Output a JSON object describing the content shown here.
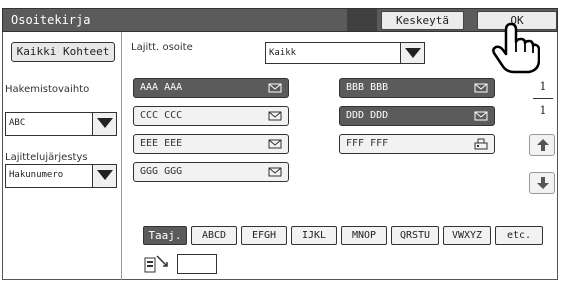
{
  "header": {
    "title": "Osoitekirja",
    "cancel_label": "Keskeytä",
    "ok_label": "OK"
  },
  "sidebar": {
    "all_destinations_label": "Kaikki Kohteet",
    "search_switch_label": "Hakemistovaihto",
    "search_switch_value": "ABC",
    "sort_order_label": "Lajittelujärjestys",
    "sort_order_value": "Hakunumero"
  },
  "filter": {
    "label": "Lajitt. osoite",
    "value": "Kaikk"
  },
  "addresses": [
    {
      "name": "AAA AAA",
      "type": "email",
      "selected": true
    },
    {
      "name": "BBB BBB",
      "type": "email",
      "selected": true
    },
    {
      "name": "CCC CCC",
      "type": "email",
      "selected": false
    },
    {
      "name": "DDD DDD",
      "type": "email",
      "selected": true
    },
    {
      "name": "EEE EEE",
      "type": "email",
      "selected": false
    },
    {
      "name": "FFF FFF",
      "type": "fax",
      "selected": false
    },
    {
      "name": "GGG GGG",
      "type": "email",
      "selected": false
    }
  ],
  "pagination": {
    "current": "1",
    "total": "1"
  },
  "index_tabs": [
    {
      "label": "Taaj.",
      "active": true
    },
    {
      "label": "ABCD",
      "active": false
    },
    {
      "label": "EFGH",
      "active": false
    },
    {
      "label": "IJKL",
      "active": false
    },
    {
      "label": "MNOP",
      "active": false
    },
    {
      "label": "QRSTU",
      "active": false
    },
    {
      "label": "VWXYZ",
      "active": false
    },
    {
      "label": "etc.",
      "active": false
    }
  ],
  "direct_input": {
    "value": ""
  },
  "colors": {
    "selected_bg": "#5b5b5b",
    "unselected_bg": "#f2f2f2",
    "titlebar_bg": "#5b5b5b"
  }
}
